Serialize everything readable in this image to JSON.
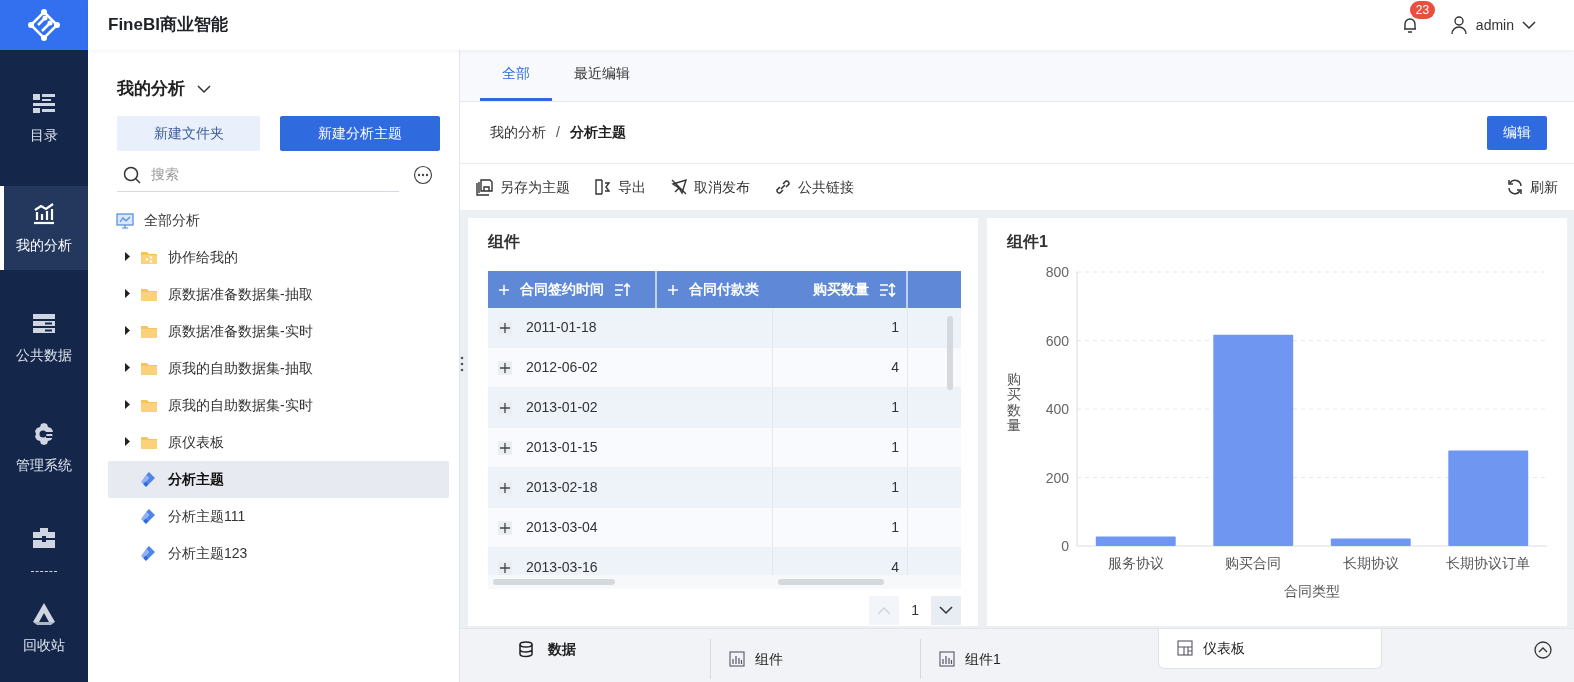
{
  "app": {
    "title": "FineBI商业智能"
  },
  "header": {
    "notification_count": "23",
    "user": "admin"
  },
  "nav": [
    {
      "label": "目录",
      "selected": false
    },
    {
      "label": "我的分析",
      "selected": true
    },
    {
      "label": "公共数据",
      "selected": false
    },
    {
      "label": "管理系统",
      "selected": false
    },
    {
      "selected": false
    },
    {
      "label": "回收站",
      "selected": false
    }
  ],
  "side": {
    "title": "我的分析",
    "buttons": [
      {
        "label": "新建文件夹",
        "kind": "secondary"
      },
      {
        "label": "新建分析主题",
        "kind": "primary"
      }
    ],
    "search": {
      "placeholder": "搜索"
    },
    "tree": [
      {
        "label": "全部分析",
        "kind": "root",
        "selected": false,
        "children": [
          {
            "label": "协作给我的",
            "kind": "shared",
            "expanded": false,
            "selected": false
          },
          {
            "label": "原数据准备数据集-抽取",
            "kind": "folder",
            "expanded": false,
            "selected": false
          },
          {
            "label": "原数据准备数据集-实时",
            "kind": "folder",
            "expanded": false,
            "selected": false
          },
          {
            "label": "原我的自助数据集-抽取",
            "kind": "folder",
            "expanded": false,
            "selected": false
          },
          {
            "label": "原我的自助数据集-实时",
            "kind": "folder",
            "expanded": false,
            "selected": false
          },
          {
            "label": "原仪表板",
            "kind": "folder",
            "expanded": false,
            "selected": false
          },
          {
            "label": "分析主题",
            "kind": "topic",
            "selected": true
          },
          {
            "label": "分析主题111",
            "kind": "topic",
            "selected": false
          },
          {
            "label": "分析主题123",
            "kind": "topic",
            "selected": false
          }
        ]
      }
    ]
  },
  "tabs": [
    {
      "label": "全部",
      "selected": true
    },
    {
      "label": "最近编辑",
      "selected": false
    }
  ],
  "breadcrumb": [
    "我的分析",
    "分析主题"
  ],
  "breadcrumb_separator": "/",
  "edit_button": "编辑",
  "toolbar": [
    "另存为主题",
    "导出",
    "取消发布",
    "公共链接"
  ],
  "refresh": "刷新",
  "table_widget": {
    "title": "组件",
    "columns": [
      "合同签约时间",
      "合同付款类",
      "购买数量"
    ],
    "rows": [
      [
        "2011-01-18",
        "1"
      ],
      [
        "2012-06-02",
        "4"
      ],
      [
        "2013-01-02",
        "1"
      ],
      [
        "2013-01-15",
        "1"
      ],
      [
        "2013-02-18",
        "1"
      ],
      [
        "2013-03-04",
        "1"
      ],
      [
        "2013-03-16",
        "4"
      ]
    ],
    "page": "1"
  },
  "chart_widget": {
    "title": "组件1",
    "chart_data": {
      "type": "bar",
      "xlabel": "合同类型",
      "ylabel": "购买数量",
      "categories": [
        "服务协议",
        "购买合同",
        "长期协议",
        "长期协议订单"
      ],
      "values": [
        28,
        617,
        22,
        279
      ],
      "ylim": [
        0,
        800
      ],
      "yticks": [
        0,
        200,
        400,
        600,
        800
      ],
      "grid": true
    }
  },
  "bottom_tabs": [
    {
      "label": "数据",
      "kind": "data",
      "selected": false
    },
    {
      "label": "组件",
      "kind": "widget",
      "selected": false
    },
    {
      "label": "组件1",
      "kind": "widget",
      "selected": false
    },
    {
      "label": "仪表板",
      "kind": "dashboard",
      "selected": true
    }
  ]
}
